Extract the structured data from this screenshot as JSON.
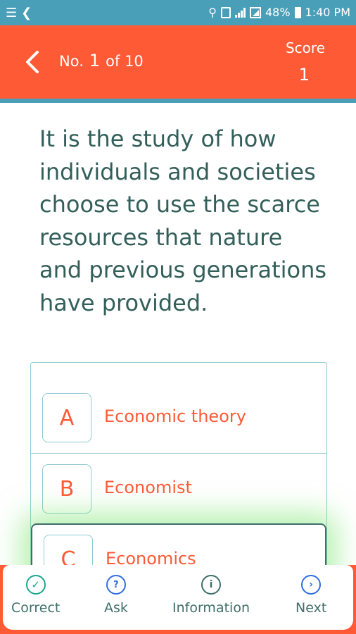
{
  "status_bar": {
    "battery": "48%",
    "time": "1:40 PM"
  },
  "header": {
    "number_prefix": "No.",
    "number": "1",
    "number_suffix": "of 10",
    "score_label": "Score",
    "score_value": "1",
    "color": "#ff5a36"
  },
  "question": {
    "text": "It is the study of how individuals and societies choose to use the scarce resources that nature and previous generations have provided."
  },
  "options": [
    {
      "letter": "A",
      "text": "Economic theory"
    },
    {
      "letter": "B",
      "text": "Economist"
    },
    {
      "letter": "C",
      "text": "Economics",
      "highlighted": true
    }
  ],
  "bottom_nav": [
    {
      "label": "Correct",
      "icon": "check-circle-icon"
    },
    {
      "label": "Ask",
      "icon": "question-circle-icon"
    },
    {
      "label": "Information",
      "icon": "info-circle-icon"
    },
    {
      "label": "Next",
      "icon": "chevron-right-circle-icon"
    }
  ]
}
